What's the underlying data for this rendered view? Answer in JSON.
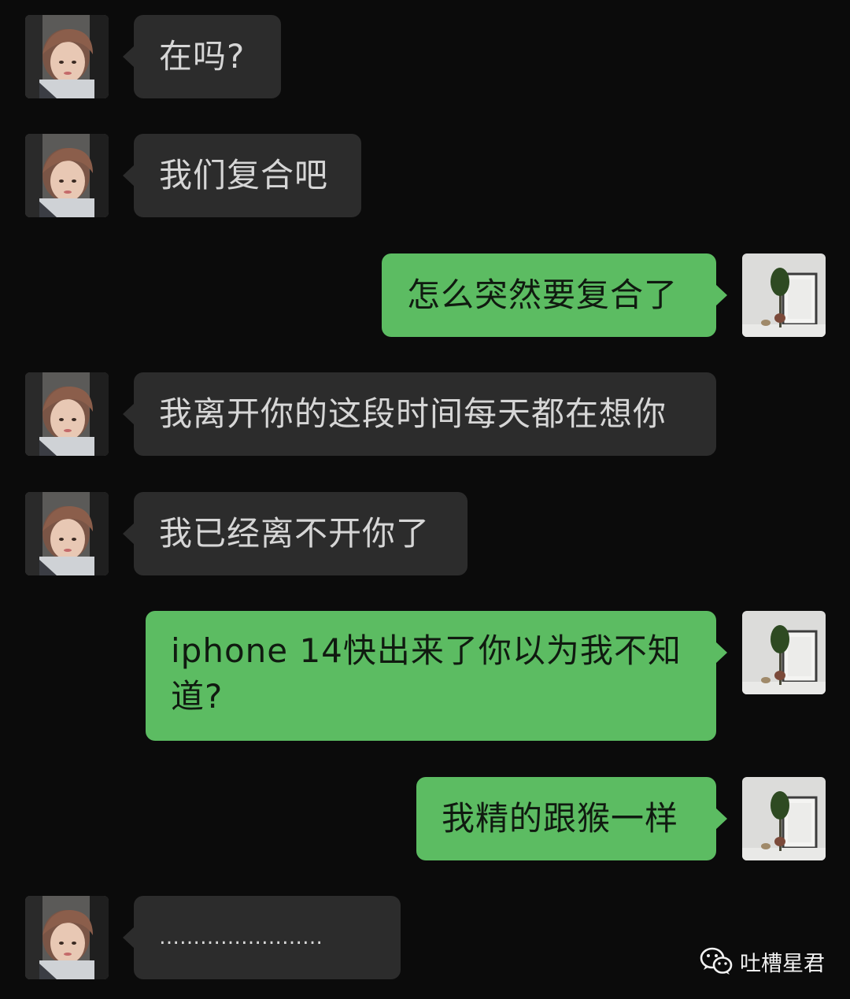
{
  "chat": {
    "messages": [
      {
        "side": "in",
        "text": "在吗?"
      },
      {
        "side": "in",
        "text": "我们复合吧"
      },
      {
        "side": "out",
        "text": "怎么突然要复合了"
      },
      {
        "side": "in",
        "text": "我离开你的这段时间每天都在想你"
      },
      {
        "side": "in",
        "text": "我已经离不开你了"
      },
      {
        "side": "out",
        "line1": "iphone  14快出来了你以为我不知",
        "line2": "道?"
      },
      {
        "side": "out",
        "text": "我精的跟猴一样"
      },
      {
        "side": "in",
        "text": "……………………"
      }
    ]
  },
  "watermark": {
    "label": "吐槽星君",
    "icon": "wechat-icon"
  },
  "colors": {
    "background": "#0b0b0b",
    "incoming_bubble": "#2c2c2c",
    "outgoing_bubble": "#5cbc62"
  }
}
